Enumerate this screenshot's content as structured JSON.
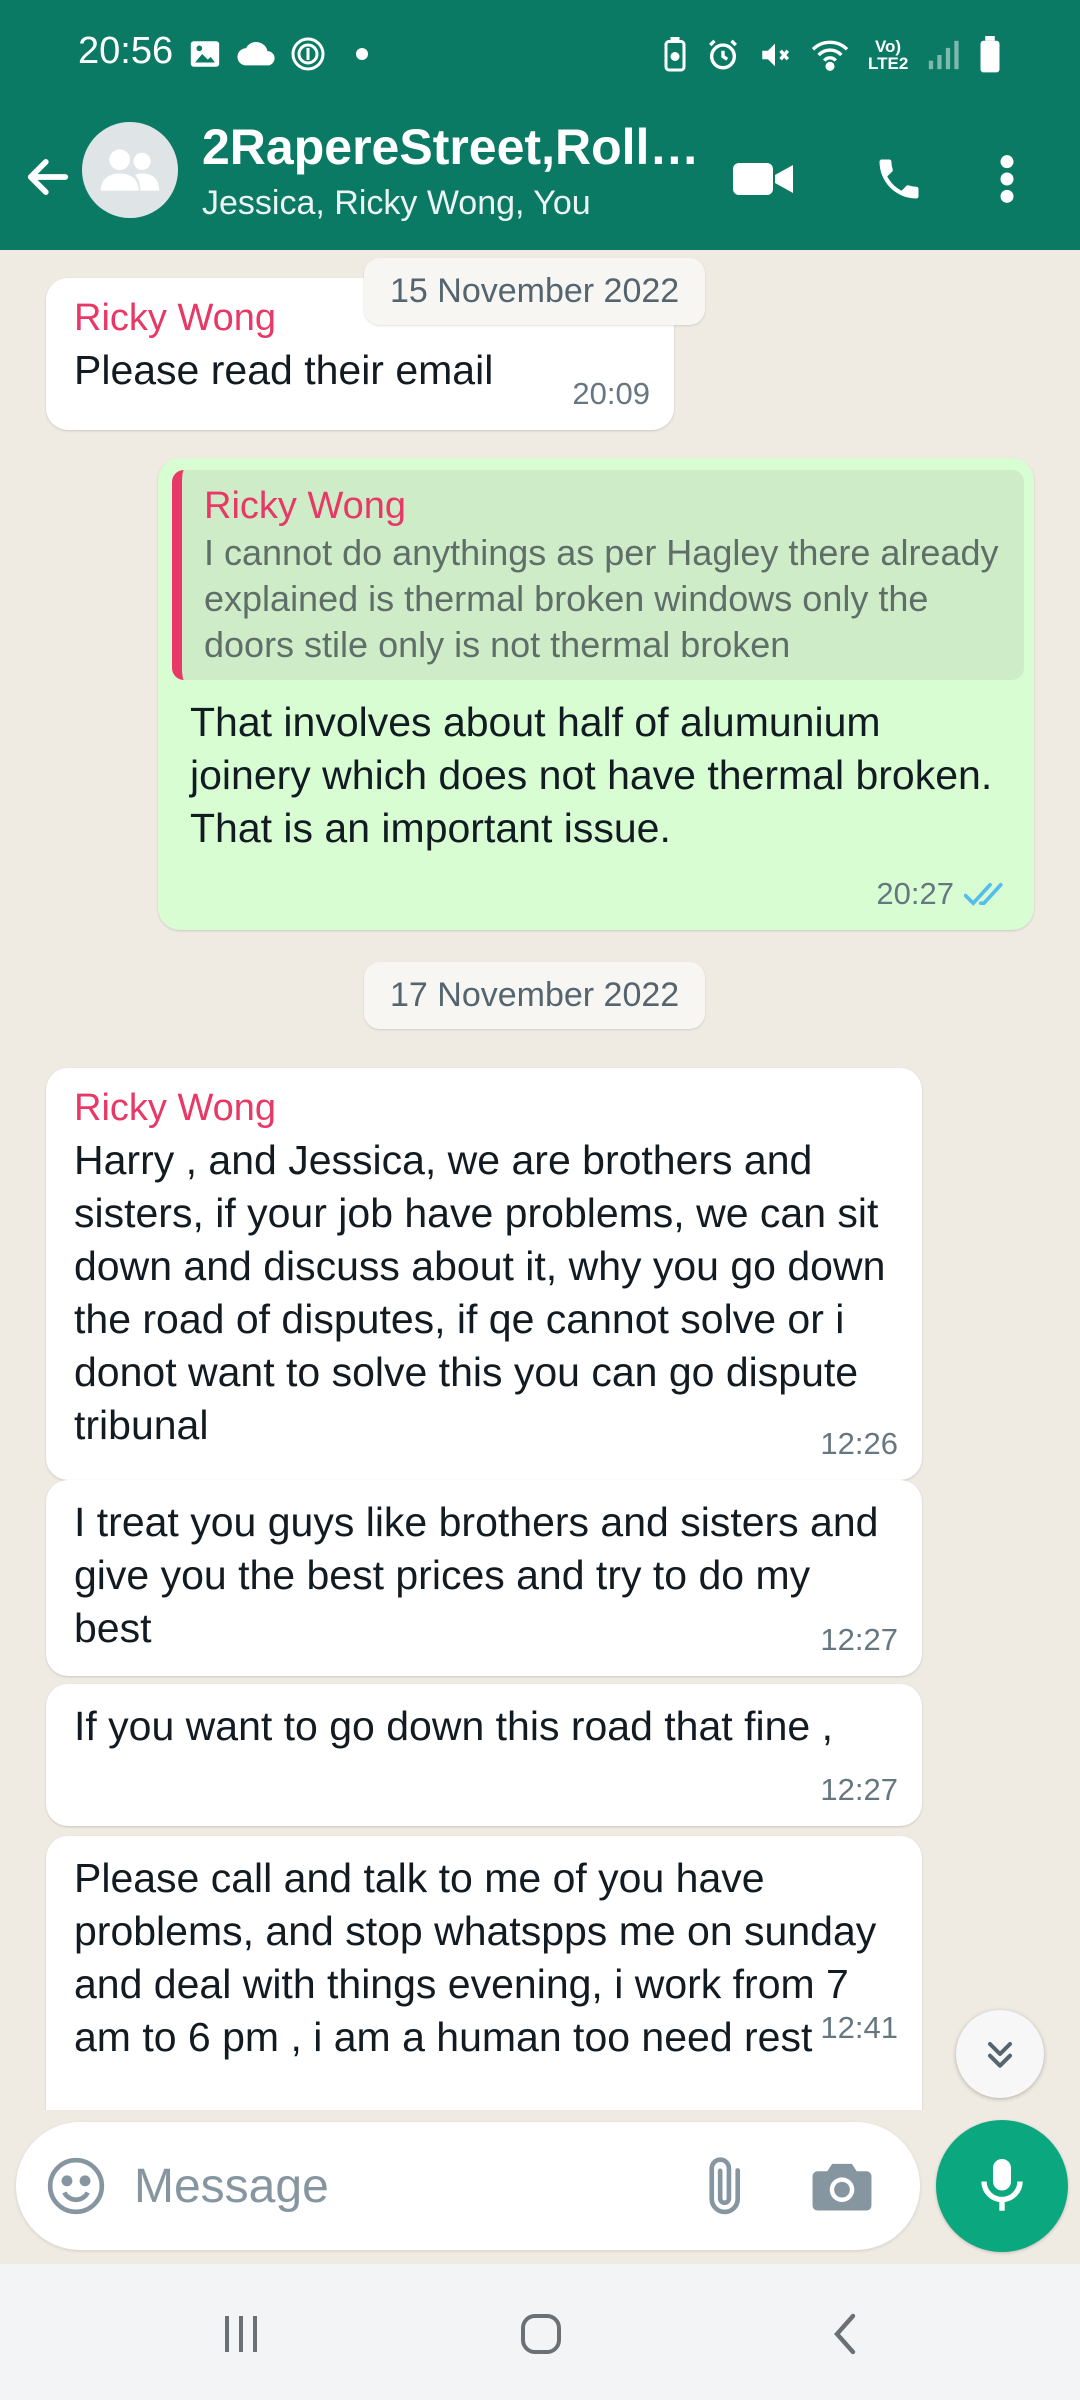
{
  "status_bar": {
    "time": "20:56",
    "icons_left": [
      "gallery-icon",
      "cloud-icon",
      "fingerprint-icon",
      "dot"
    ],
    "icons_right": [
      "battery-saver-icon",
      "alarm-icon",
      "mute-icon",
      "wifi-icon",
      "volte-icon",
      "signal-icon",
      "battery-icon"
    ],
    "volte_label": "Vo) LTE2"
  },
  "header": {
    "title": "2RapereStreet,Rolle...",
    "subtitle": "Jessica, Ricky Wong, You",
    "brand_color": "#0b7a64"
  },
  "chat": {
    "date_chips": [
      "15 November 2022",
      "17 November 2022"
    ],
    "messages": [
      {
        "direction": "in",
        "sender": "Ricky Wong",
        "text": "Please read their email",
        "time": "20:09"
      },
      {
        "direction": "out",
        "quote_sender": "Ricky Wong",
        "quote_text": "I cannot do anythings as per Hagley there already explained is thermal broken windows only the doors stile only is not thermal broken",
        "text": "That involves about half of alumunium joinery which does not have thermal broken. That is an important issue.",
        "time": "20:27",
        "status": "read"
      },
      {
        "direction": "in",
        "sender": "Ricky Wong",
        "text": "Harry , and Jessica, we are brothers and sisters, if your job have problems, we can sit down and discuss about it, why you go down the road of disputes, if qe cannot solve or i donot want to  solve this you can go dispute tribunal",
        "time": "12:26"
      },
      {
        "direction": "in",
        "text": "I treat you guys like brothers and sisters and give you the best prices and try to do my best",
        "time": "12:27"
      },
      {
        "direction": "in",
        "text": "If you want to go down this road that fine ,",
        "time": "12:27"
      },
      {
        "direction": "in",
        "text": "Please call and talk to me of you have problems, and stop whatspps me on sunday and deal with things evening, i work from 7 am to 6 pm , i am a human too need rest",
        "time": "12:41"
      }
    ]
  },
  "input": {
    "placeholder": "Message"
  },
  "colors": {
    "accent": "#0ba77e",
    "sender_name": "#e83866",
    "outgoing_bubble": "#d9fdd3",
    "read_ticks": "#53bdeb"
  }
}
